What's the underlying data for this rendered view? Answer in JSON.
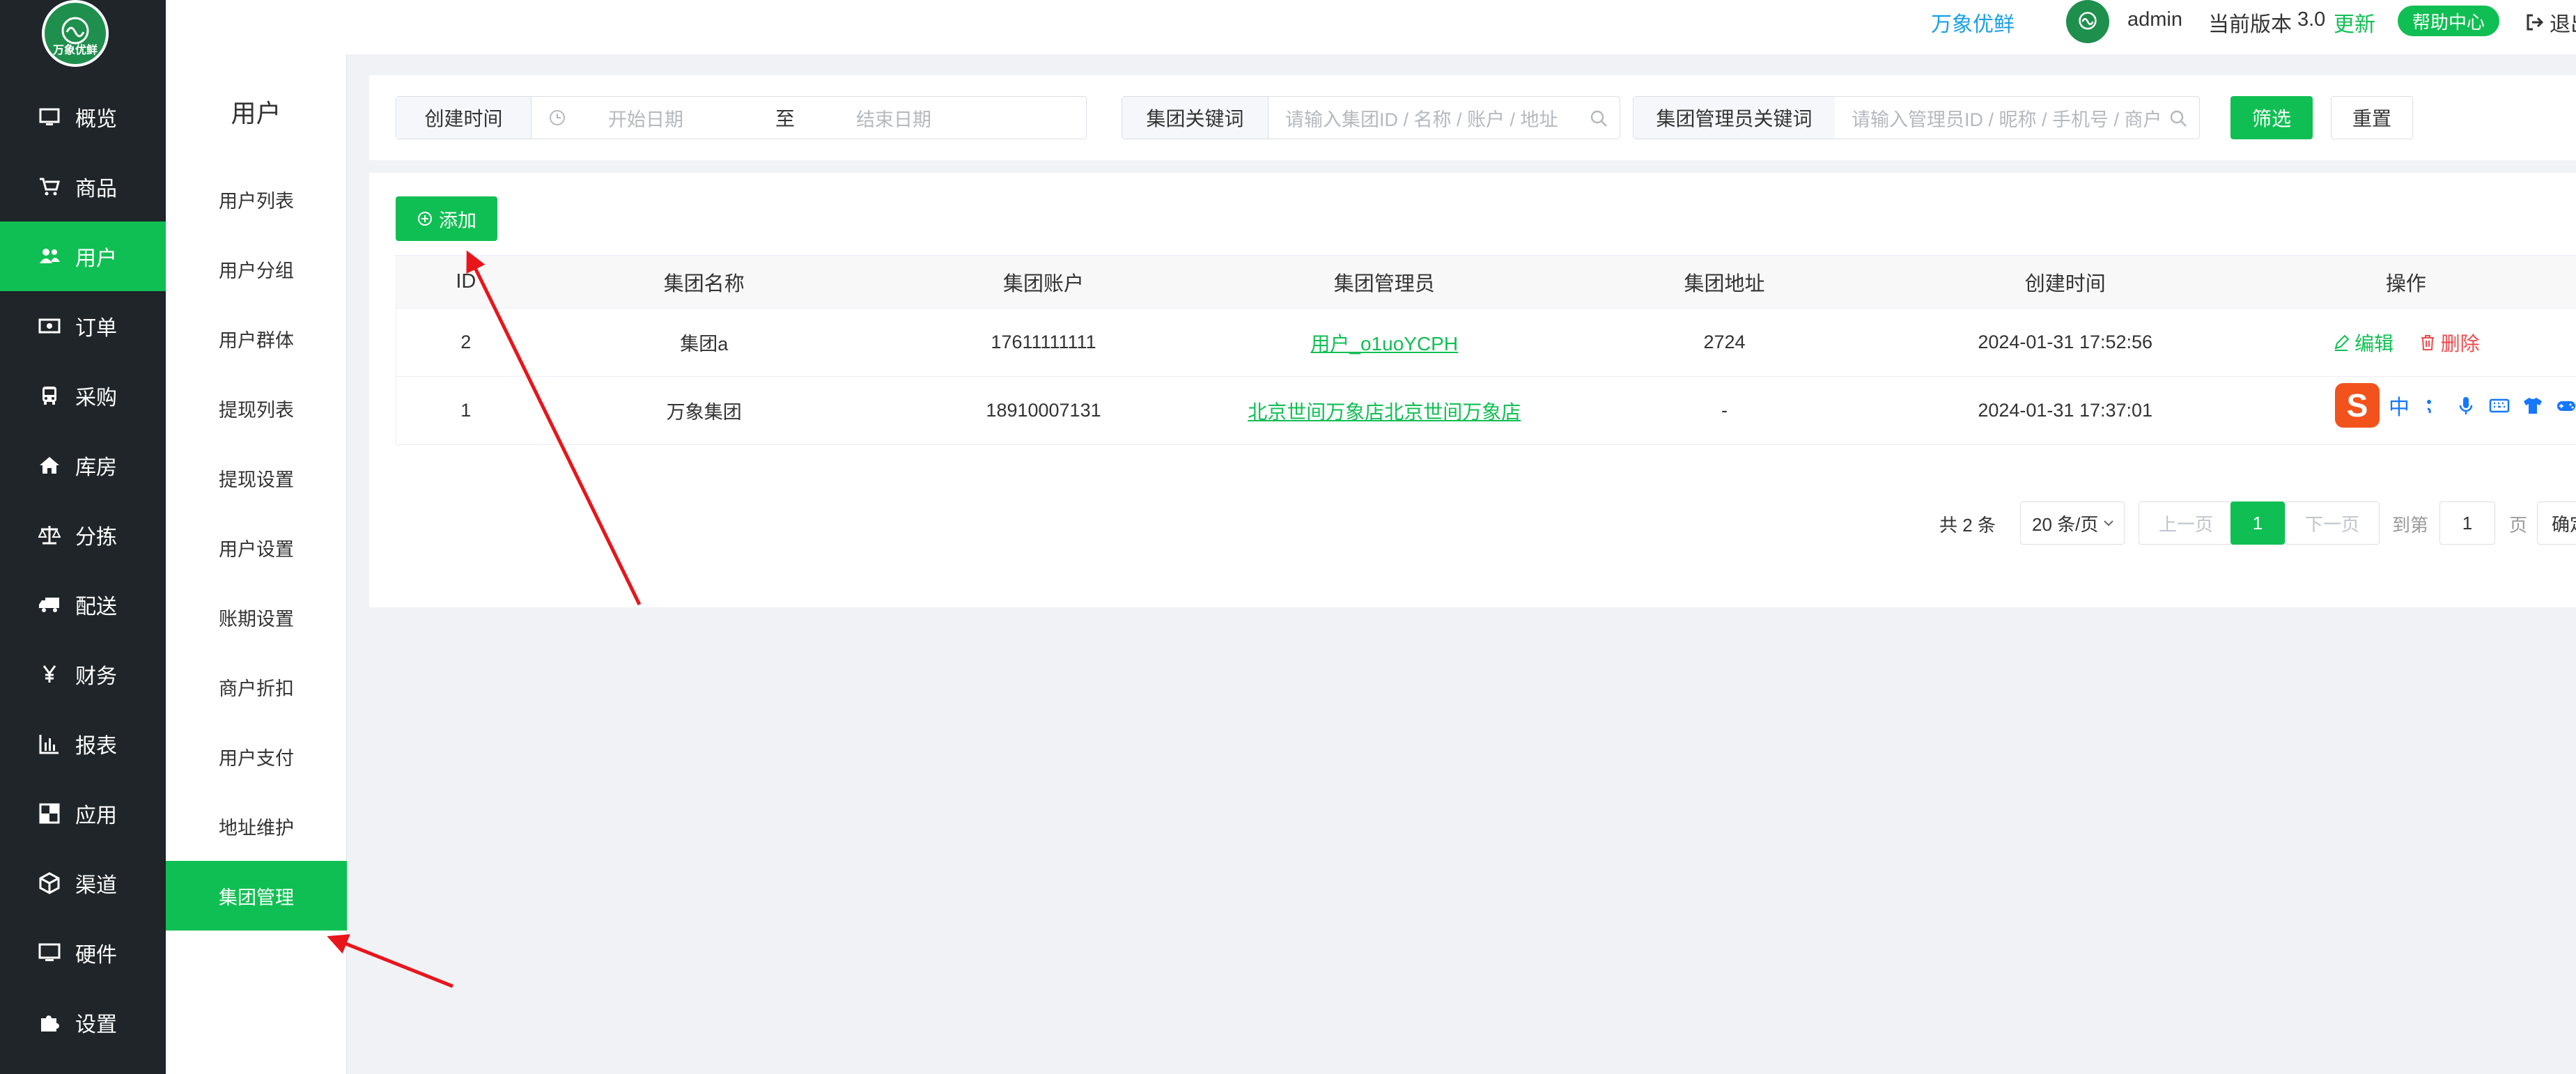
{
  "nav": {
    "logo_text": "万象优鲜",
    "items": [
      {
        "label": "概览",
        "icon": "monitor-icon"
      },
      {
        "label": "商品",
        "icon": "cart-icon"
      },
      {
        "label": "用户",
        "icon": "users-icon"
      },
      {
        "label": "订单",
        "icon": "money-icon"
      },
      {
        "label": "采购",
        "icon": "bus-icon"
      },
      {
        "label": "库房",
        "icon": "home-icon"
      },
      {
        "label": "分拣",
        "icon": "scale-icon"
      },
      {
        "label": "配送",
        "icon": "truck-icon"
      },
      {
        "label": "财务",
        "icon": "yen-icon"
      },
      {
        "label": "报表",
        "icon": "bar-chart-icon"
      },
      {
        "label": "应用",
        "icon": "apps-icon"
      },
      {
        "label": "渠道",
        "icon": "cube-icon"
      },
      {
        "label": "硬件",
        "icon": "desktop-icon"
      },
      {
        "label": "设置",
        "icon": "puzzle-icon"
      }
    ],
    "active_index": 2
  },
  "submenu": {
    "title": "用户",
    "items": [
      "用户列表",
      "用户分组",
      "用户群体",
      "提现列表",
      "提现设置",
      "用户设置",
      "账期设置",
      "商户折扣",
      "用户支付",
      "地址维护",
      "集团管理"
    ],
    "active_index": 10
  },
  "header": {
    "brand": "万象优鲜",
    "user": "admin",
    "version_label": "当前版本",
    "version": "3.0",
    "update": "更新",
    "help": "帮助中心",
    "logout": "退出"
  },
  "filters": {
    "created_label": "创建时间",
    "start_placeholder": "开始日期",
    "range_sep": "至",
    "end_placeholder": "结束日期",
    "group_kw_label": "集团关键词",
    "group_kw_placeholder": "请输入集团ID / 名称 / 账户 / 地址",
    "admin_kw_label": "集团管理员关键词",
    "admin_kw_placeholder": "请输入管理员ID / 昵称 / 手机号 / 商户",
    "filter_btn": "筛选",
    "reset_btn": "重置"
  },
  "table": {
    "add_btn": "添加",
    "columns": [
      "ID",
      "集团名称",
      "集团账户",
      "集团管理员",
      "集团地址",
      "创建时间",
      "操作"
    ],
    "rows": [
      {
        "id": "2",
        "name": "集团a",
        "account": "17611111111",
        "admin": "用户_o1uoYCPH",
        "address": "2724",
        "created": "2024-01-31 17:52:56"
      },
      {
        "id": "1",
        "name": "万象集团",
        "account": "18910007131",
        "admin": "北京世间万象店北京世间万象店",
        "address": "-",
        "created": "2024-01-31 17:37:01"
      }
    ],
    "edit": "编辑",
    "delete": "删除"
  },
  "ime": {
    "logo": "S",
    "lang": "中"
  },
  "pager": {
    "total": "共 2 条",
    "size": "20 条/页",
    "prev": "上一页",
    "current": "1",
    "next": "下一页",
    "goto": "到第",
    "goto_value": "1",
    "page_unit": "页",
    "confirm": "确定"
  },
  "colors": {
    "primary": "#10bf53",
    "nav_bg": "#1f2528",
    "danger": "#ef4b4b",
    "link_blue": "#1aa0e6",
    "annotation": "#e8151b"
  }
}
